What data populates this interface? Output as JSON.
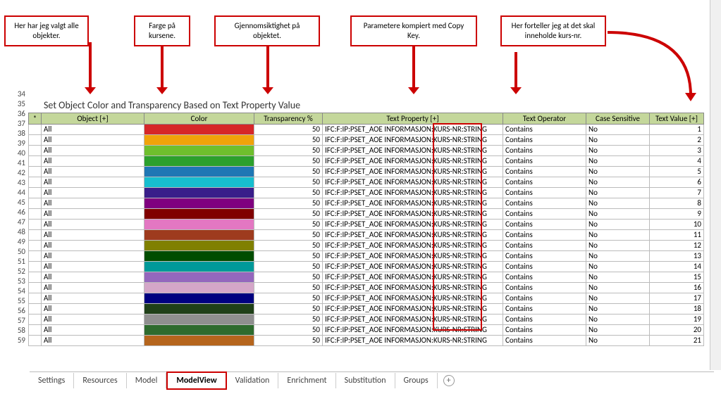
{
  "callouts": {
    "c1": "Her har jeg valgt\nalle objekter.",
    "c2": "Farge på\nkursene.",
    "c3": "Gjennomsiktighet på\nobjektet.",
    "c4": "Parametere kompiert med\nCopy Key.",
    "c5": "Her forteller jeg at\ndet skal inneholde\nkurs-nr."
  },
  "title": "Set Object Color and Transparency Based on Text Property Value",
  "headers": {
    "object": "Object [+]",
    "color": "Color",
    "transparency": "Transparency %",
    "text_property": "Text Property [+]",
    "text_operator": "Text Operator",
    "case_sensitive": "Case Sensitive",
    "text_value": "Text Value [+]"
  },
  "rownums": [
    "34",
    "35",
    "36",
    "37",
    "38",
    "39",
    "40",
    "41",
    "42",
    "43",
    "44",
    "45",
    "46",
    "47",
    "48",
    "49",
    "50",
    "51",
    "52",
    "53",
    "54",
    "55",
    "56",
    "57",
    "58",
    "59"
  ],
  "tabs": [
    "Settings",
    "Resources",
    "Model",
    "ModelView",
    "Validation",
    "Enrichment",
    "Substitution",
    "Groups"
  ],
  "active_tab": "ModelView",
  "chart_data": {
    "type": "table",
    "columns": [
      "Object",
      "Color",
      "Transparency %",
      "Text Property",
      "Text Operator",
      "Case Sensitive",
      "Text Value"
    ],
    "rows": [
      {
        "object": "All",
        "color": "#d62728",
        "trans": 50,
        "tprop": "IFC:F:IP:PSET_AOE INFORMASJON:KURS-NR:STRING",
        "toper": "Contains",
        "csen": "No",
        "tval": 1
      },
      {
        "object": "All",
        "color": "#f0a30a",
        "trans": 50,
        "tprop": "IFC:F:IP:PSET_AOE INFORMASJON:KURS-NR:STRING",
        "toper": "Contains",
        "csen": "No",
        "tval": 2
      },
      {
        "object": "All",
        "color": "#6fbf2d",
        "trans": 50,
        "tprop": "IFC:F:IP:PSET_AOE INFORMASJON:KURS-NR:STRING",
        "toper": "Contains",
        "csen": "No",
        "tval": 3
      },
      {
        "object": "All",
        "color": "#2ca02c",
        "trans": 50,
        "tprop": "IFC:F:IP:PSET_AOE INFORMASJON:KURS-NR:STRING",
        "toper": "Contains",
        "csen": "No",
        "tval": 4
      },
      {
        "object": "All",
        "color": "#1f77b4",
        "trans": 50,
        "tprop": "IFC:F:IP:PSET_AOE INFORMASJON:KURS-NR:STRING",
        "toper": "Contains",
        "csen": "No",
        "tval": 5
      },
      {
        "object": "All",
        "color": "#17becf",
        "trans": 50,
        "tprop": "IFC:F:IP:PSET_AOE INFORMASJON:KURS-NR:STRING",
        "toper": "Contains",
        "csen": "No",
        "tval": 6
      },
      {
        "object": "All",
        "color": "#391e8a",
        "trans": 50,
        "tprop": "IFC:F:IP:PSET_AOE INFORMASJON:KURS-NR:STRING",
        "toper": "Contains",
        "csen": "No",
        "tval": 7
      },
      {
        "object": "All",
        "color": "#7f007f",
        "trans": 50,
        "tprop": "IFC:F:IP:PSET_AOE INFORMASJON:KURS-NR:STRING",
        "toper": "Contains",
        "csen": "No",
        "tval": 8
      },
      {
        "object": "All",
        "color": "#800000",
        "trans": 50,
        "tprop": "IFC:F:IP:PSET_AOE INFORMASJON:KURS-NR:STRING",
        "toper": "Contains",
        "csen": "No",
        "tval": 9
      },
      {
        "object": "All",
        "color": "#e377c2",
        "trans": 50,
        "tprop": "IFC:F:IP:PSET_AOE INFORMASJON:KURS-NR:STRING",
        "toper": "Contains",
        "csen": "No",
        "tval": 10
      },
      {
        "object": "All",
        "color": "#9e3b1e",
        "trans": 50,
        "tprop": "IFC:F:IP:PSET_AOE INFORMASJON:KURS-NR:STRING",
        "toper": "Contains",
        "csen": "No",
        "tval": 11
      },
      {
        "object": "All",
        "color": "#808000",
        "trans": 50,
        "tprop": "IFC:F:IP:PSET_AOE INFORMASJON:KURS-NR:STRING",
        "toper": "Contains",
        "csen": "No",
        "tval": 12
      },
      {
        "object": "All",
        "color": "#004d00",
        "trans": 50,
        "tprop": "IFC:F:IP:PSET_AOE INFORMASJON:KURS-NR:STRING",
        "toper": "Contains",
        "csen": "No",
        "tval": 13
      },
      {
        "object": "All",
        "color": "#009999",
        "trans": 50,
        "tprop": "IFC:F:IP:PSET_AOE INFORMASJON:KURS-NR:STRING",
        "toper": "Contains",
        "csen": "No",
        "tval": 14
      },
      {
        "object": "All",
        "color": "#9467bd",
        "trans": 50,
        "tprop": "IFC:F:IP:PSET_AOE INFORMASJON:KURS-NR:STRING",
        "toper": "Contains",
        "csen": "No",
        "tval": 15
      },
      {
        "object": "All",
        "color": "#d4a6c8",
        "trans": 50,
        "tprop": "IFC:F:IP:PSET_AOE INFORMASJON:KURS-NR:STRING",
        "toper": "Contains",
        "csen": "No",
        "tval": 16
      },
      {
        "object": "All",
        "color": "#000080",
        "trans": 50,
        "tprop": "IFC:F:IP:PSET_AOE INFORMASJON:KURS-NR:STRING",
        "toper": "Contains",
        "csen": "No",
        "tval": 17
      },
      {
        "object": "All",
        "color": "#1f4018",
        "trans": 50,
        "tprop": "IFC:F:IP:PSET_AOE INFORMASJON:KURS-NR:STRING",
        "toper": "Contains",
        "csen": "No",
        "tval": 18
      },
      {
        "object": "All",
        "color": "#8f8f8f",
        "trans": 50,
        "tprop": "IFC:F:IP:PSET_AOE INFORMASJON:KURS-NR:STRING",
        "toper": "Contains",
        "csen": "No",
        "tval": 19
      },
      {
        "object": "All",
        "color": "#2e6b2e",
        "trans": 50,
        "tprop": "IFC:F:IP:PSET_AOE INFORMASJON:KURS-NR:STRING",
        "toper": "Contains",
        "csen": "No",
        "tval": 20
      },
      {
        "object": "All",
        "color": "#b5651d",
        "trans": 50,
        "tprop": "IFC:F:IP:PSET_AOE INFORMASJON:KURS-NR:STRING",
        "toper": "Contains",
        "csen": "No",
        "tval": 21
      }
    ]
  }
}
